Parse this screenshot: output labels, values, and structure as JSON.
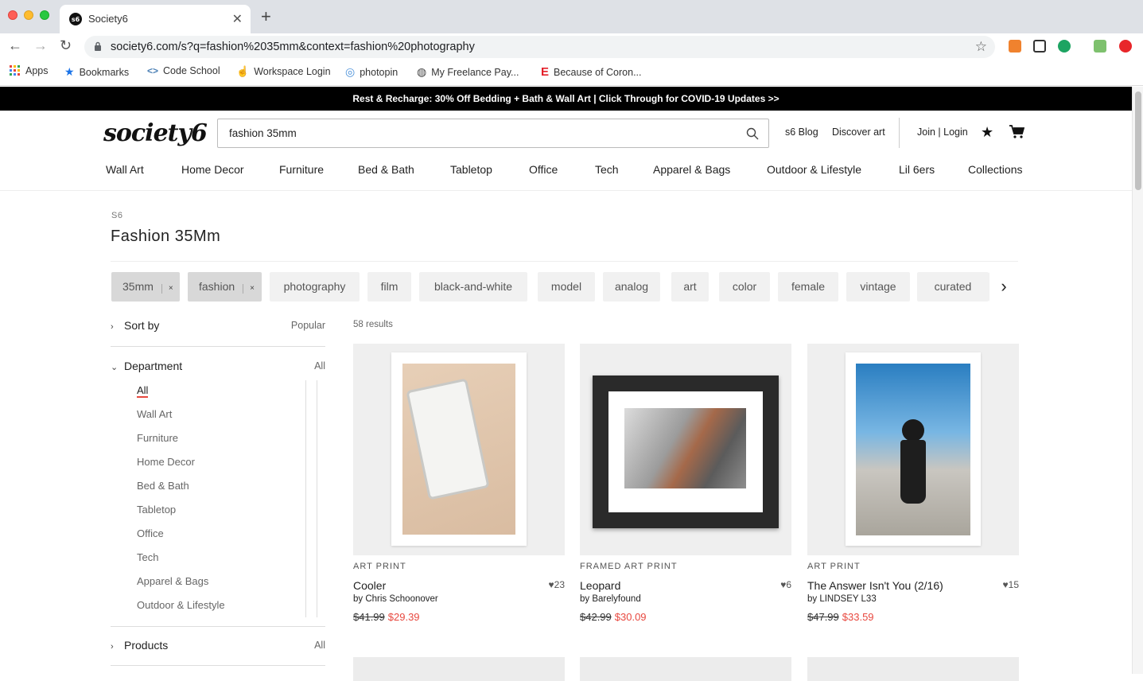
{
  "browser": {
    "tab_title": "Society6",
    "tab_favicon_text": "s6",
    "url": "society6.com/s?q=fashion%2035mm&context=fashion%20photography",
    "bookmarks": [
      "Apps",
      "Bookmarks",
      "Code School",
      "Workspace Login",
      "photopin",
      "My Freelance Pay...",
      "Because of Coron..."
    ]
  },
  "promo": "Rest & Recharge: 30% Off Bedding + Bath & Wall Art | Click Through for COVID-19 Updates >>",
  "header": {
    "logo": "society6",
    "search_value": "fashion 35mm",
    "blog": "s6 Blog",
    "discover": "Discover art",
    "login": "Join | Login"
  },
  "categories": [
    "Wall Art",
    "Home Decor",
    "Furniture",
    "Bed & Bath",
    "Tabletop",
    "Office",
    "Tech",
    "Apparel & Bags",
    "Outdoor & Lifestyle",
    "Lil 6ers",
    "Collections"
  ],
  "breadcrumb": "S6",
  "page_title": "Fashion 35Mm",
  "chips": [
    {
      "label": "35mm",
      "selected": true
    },
    {
      "label": "fashion",
      "selected": true
    },
    {
      "label": "photography",
      "selected": false
    },
    {
      "label": "film",
      "selected": false
    },
    {
      "label": "black-and-white",
      "selected": false
    },
    {
      "label": "model",
      "selected": false
    },
    {
      "label": "analog",
      "selected": false
    },
    {
      "label": "art",
      "selected": false
    },
    {
      "label": "color",
      "selected": false
    },
    {
      "label": "female",
      "selected": false
    },
    {
      "label": "vintage",
      "selected": false
    },
    {
      "label": "curated",
      "selected": false
    }
  ],
  "chip_remove": "×",
  "sidebar": {
    "sort_label": "Sort by",
    "sort_value": "Popular",
    "department_label": "Department",
    "department_value": "All",
    "departments": [
      "All",
      "Wall Art",
      "Furniture",
      "Home Decor",
      "Bed & Bath",
      "Tabletop",
      "Office",
      "Tech",
      "Apparel & Bags",
      "Outdoor & Lifestyle"
    ],
    "products_label": "Products",
    "products_value": "All"
  },
  "results_count": "58 results",
  "products": [
    {
      "type": "ART PRINT",
      "name": "Cooler",
      "artist": "by Chris Schoonover",
      "likes": "23",
      "old_price": "$41.99",
      "new_price": "$29.39"
    },
    {
      "type": "FRAMED ART PRINT",
      "name": "Leopard",
      "artist": "by Barelyfound",
      "likes": "6",
      "old_price": "$42.99",
      "new_price": "$30.09"
    },
    {
      "type": "ART PRINT",
      "name": "The Answer Isn't You (2/16)",
      "artist": "by LINDSEY L33",
      "likes": "15",
      "old_price": "$47.99",
      "new_price": "$33.59"
    }
  ],
  "colors": {
    "accent": "#e8483f",
    "promo_bg": "#000000"
  }
}
